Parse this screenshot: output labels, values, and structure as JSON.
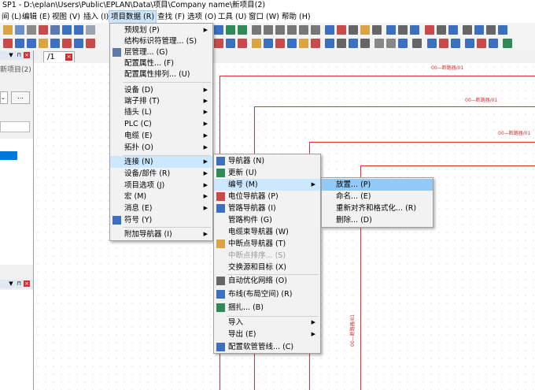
{
  "title": "SP1 - D:\\eplan\\Users\\Public\\EPLAN\\Data\\项目\\Company name\\新项目(2)",
  "menubar": [
    {
      "label": "间 (L)"
    },
    {
      "label": "编辑 (E)"
    },
    {
      "label": "视图 (V)"
    },
    {
      "label": "插入 (I)"
    },
    {
      "label": "项目数据 (R)"
    },
    {
      "label": "查找 (F)"
    },
    {
      "label": "选项 (O)"
    },
    {
      "label": "工具 (U)"
    },
    {
      "label": "窗口 (W)"
    },
    {
      "label": "帮助 (H)"
    }
  ],
  "left_panel": {
    "title_fragment": "新项目(2)",
    "button_label": "..."
  },
  "tab": {
    "label": "/1"
  },
  "menu1": {
    "items": [
      {
        "label": "预规划 (P)",
        "sub": true
      },
      {
        "label": "结构标识符管理... (S)"
      },
      {
        "label": "层管理... (G)"
      },
      {
        "label": "配置属性... (F)"
      },
      {
        "label": "配置属性排列... (U)"
      },
      {
        "label": "设备 (D)",
        "sub": true
      },
      {
        "label": "端子排 (T)",
        "sub": true
      },
      {
        "label": "插头 (L)",
        "sub": true
      },
      {
        "label": "PLC (C)",
        "sub": true
      },
      {
        "label": "电缆 (E)",
        "sub": true
      },
      {
        "label": "拓扑 (O)",
        "sub": true
      },
      {
        "label": "连接 (N)",
        "sub": true
      },
      {
        "label": "设备/部件 (R)",
        "sub": true
      },
      {
        "label": "项目选项 (J)",
        "sub": true
      },
      {
        "label": "宏 (M)",
        "sub": true
      },
      {
        "label": "消息 (E)",
        "sub": true
      },
      {
        "label": "符号 (Y)"
      },
      {
        "label": "附加导航器 (I)",
        "sub": true
      }
    ]
  },
  "menu2": {
    "items": [
      {
        "label": "导航器 (N)"
      },
      {
        "label": "更新 (U)"
      },
      {
        "label": "编号 (M)",
        "sub": true
      },
      {
        "label": "电位导航器 (P)"
      },
      {
        "label": "管路导航器 (I)"
      },
      {
        "label": "管路构件 (G)"
      },
      {
        "label": "电缆束导航器 (W)"
      },
      {
        "label": "中断点导航器 (T)"
      },
      {
        "label": "中断点排序... (S)"
      },
      {
        "label": "交换源和目标 (X)"
      },
      {
        "label": "自动优化网络 (O)"
      },
      {
        "label": "布线(布局空间) (R)"
      },
      {
        "label": "捆扎... (B)"
      },
      {
        "label": "导入",
        "sub": true
      },
      {
        "label": "导出 (E)",
        "sub": true
      },
      {
        "label": "配置软管管线... (C)"
      }
    ]
  },
  "menu3": {
    "items": [
      {
        "label": "放置... (P)"
      },
      {
        "label": "命名... (E)"
      },
      {
        "label": "重新对齐和格式化... (R)"
      },
      {
        "label": "删除... (D)"
      }
    ]
  },
  "drawing_labels": [
    "00—断路器/01",
    "00—断路器/01",
    "00—断路器/01",
    "00—断路器/01"
  ],
  "colors": {
    "wire": "#e03030",
    "highlight": "#91c9f7",
    "menu_bg": "#f2f2f2"
  }
}
